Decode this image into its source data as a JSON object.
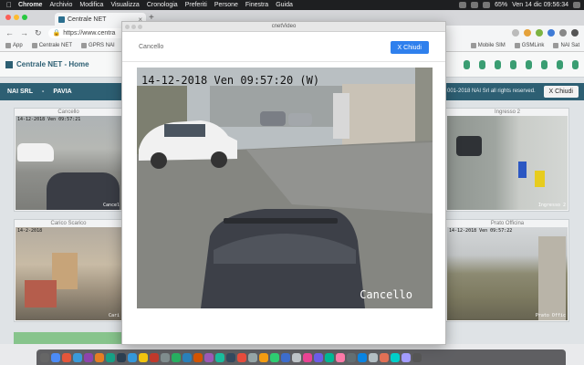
{
  "menubar": {
    "app": "Chrome",
    "items": [
      "Archivio",
      "Modifica",
      "Visualizza",
      "Cronologia",
      "Preferiti",
      "Persone",
      "Finestra",
      "Guida"
    ],
    "battery": "65%",
    "datetime": "Ven 14 dic  09:56:34"
  },
  "browser": {
    "tab_title": "Centrale NET",
    "url": "https://www.centra"
  },
  "bookmarks": [
    "App",
    "Centrale NET",
    "GPRS NAI",
    "Mobile SIM",
    "GSMLink",
    "NAI Sat"
  ],
  "page": {
    "brand": "Centrale NET - Home",
    "nav_left": [
      "NAI SRL",
      "-",
      "PAVIA"
    ],
    "copyright": "001-2018 NAI Srl all rights reserved.",
    "close_label": "X Chiudi"
  },
  "cameras": [
    {
      "caption": "Cancello",
      "timestamp": "14-12-2018 Ven 09:57:21",
      "name": "Cancel"
    },
    {
      "caption": "Ingresso 2",
      "timestamp": "",
      "name": "Ingresso 2"
    },
    {
      "caption": "Carico Scarico",
      "timestamp": "14-2-2018",
      "name": "Cari"
    },
    {
      "caption": "Prato Officina",
      "timestamp": "14-12-2018 Ven 09:57:22",
      "name": "Prato Offic"
    }
  ],
  "modal": {
    "window_title": "cnetVideo",
    "camera_label": "Cancello",
    "close_label": "X Chiudi",
    "timestamp": "14-12-2018 Ven 09:57:20 (W)",
    "camera_name": "Cancello"
  },
  "colors": {
    "nav_teal": "#2d5f73",
    "button_blue": "#2f80ed"
  }
}
